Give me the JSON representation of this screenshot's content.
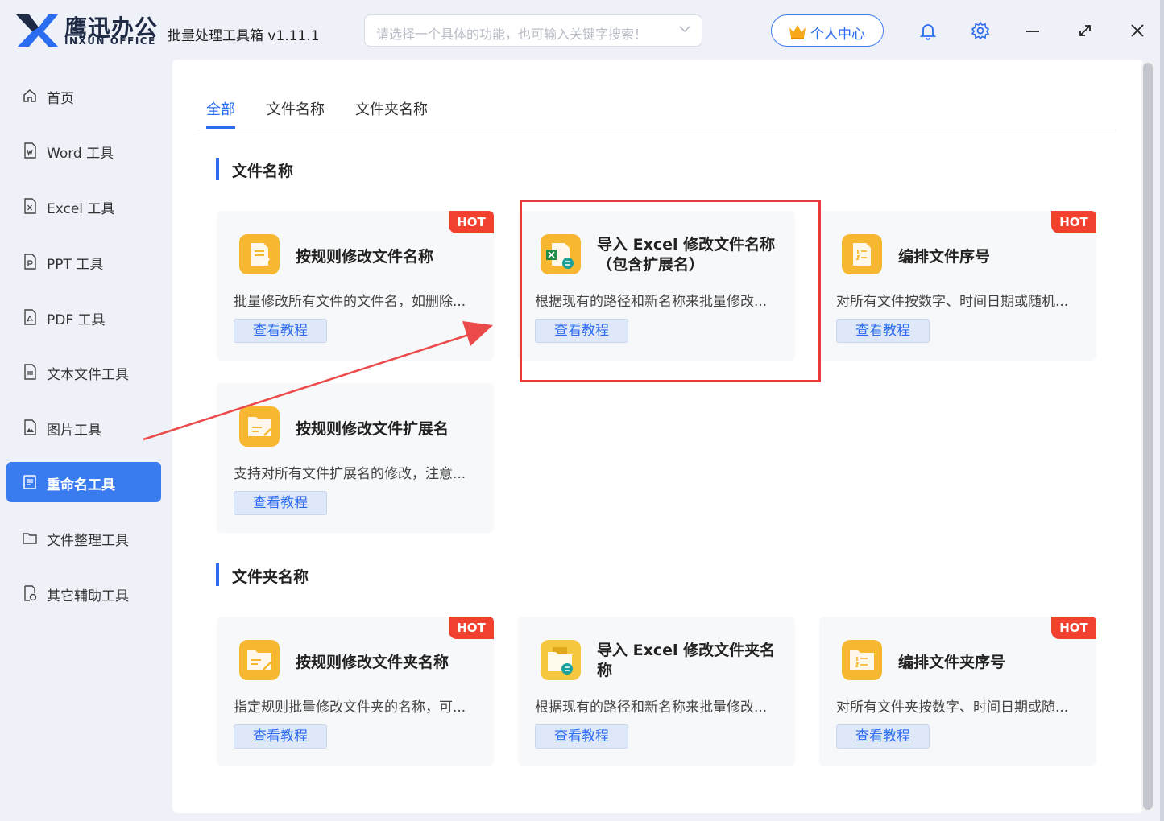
{
  "app": {
    "brand_cn": "鹰迅办公",
    "brand_en": "INXUN OFFICE",
    "title": "批量处理工具箱 v1.11.1",
    "search_placeholder": "请选择一个具体的功能，也可输入关键字搜索！",
    "user_center": "个人中心"
  },
  "sidebar": {
    "items": [
      {
        "label": "首页",
        "icon": "home-icon"
      },
      {
        "label": "Word 工具",
        "icon": "word-file-icon"
      },
      {
        "label": "Excel 工具",
        "icon": "excel-file-icon"
      },
      {
        "label": "PPT 工具",
        "icon": "ppt-file-icon"
      },
      {
        "label": "PDF 工具",
        "icon": "pdf-file-icon"
      },
      {
        "label": "文本文件工具",
        "icon": "text-file-icon"
      },
      {
        "label": "图片工具",
        "icon": "image-file-icon"
      },
      {
        "label": "重命名工具",
        "icon": "rename-icon",
        "active": true
      },
      {
        "label": "文件整理工具",
        "icon": "folder-icon"
      },
      {
        "label": "其它辅助工具",
        "icon": "misc-tool-icon"
      }
    ]
  },
  "tabs": [
    "全部",
    "文件名称",
    "文件夹名称"
  ],
  "sections": [
    {
      "title": "文件名称",
      "cards": [
        {
          "title": "按规则修改文件名称",
          "desc": "批量修改所有文件的文件名，如删除...",
          "button": "查看教程",
          "badge": "HOT"
        },
        {
          "title": "导入 Excel 修改文件名称（包含扩展名）",
          "desc": "根据现有的路径和新名称来批量修改...",
          "button": "查看教程",
          "badge": ""
        },
        {
          "title": "编排文件序号",
          "desc": "对所有文件按数字、时间日期或随机...",
          "button": "查看教程",
          "badge": "HOT"
        },
        {
          "title": "按规则修改文件扩展名",
          "desc": "支持对所有文件扩展名的修改，注意...",
          "button": "查看教程",
          "badge": ""
        }
      ]
    },
    {
      "title": "文件夹名称",
      "cards": [
        {
          "title": "按规则修改文件夹名称",
          "desc": "指定规则批量修改文件夹的名称，可...",
          "button": "查看教程",
          "badge": "HOT"
        },
        {
          "title": "导入 Excel 修改文件夹名称",
          "desc": "根据现有的路径和新名称来批量修改...",
          "button": "查看教程",
          "badge": ""
        },
        {
          "title": "编排文件夹序号",
          "desc": "对所有文件夹按数字、时间日期或随...",
          "button": "查看教程",
          "badge": "HOT"
        }
      ]
    }
  ],
  "colors": {
    "accent": "#2b6cf0",
    "hot_badge": "#f2402e",
    "card_icon": "#f7b731",
    "highlight": "#ec3a3a"
  }
}
